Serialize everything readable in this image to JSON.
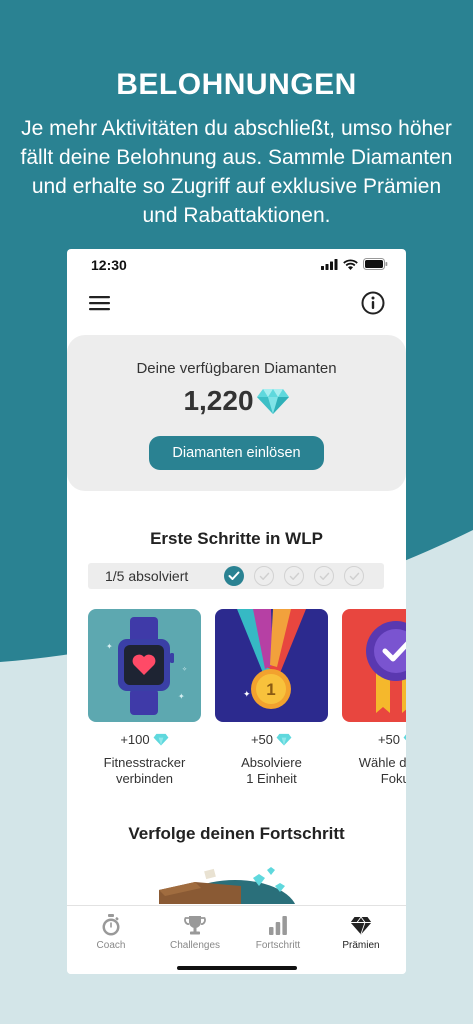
{
  "promo": {
    "title": "BELOHNUNGEN",
    "text": "Je mehr Aktivitäten du abschließt, umso höher fällt deine Belohnung aus. Sammle Diamanten und erhalte so Zugriff auf exklusive Prämien und Rabattaktionen."
  },
  "status_bar": {
    "time": "12:30"
  },
  "diamonds": {
    "label": "Deine verfügbaren Diamanten",
    "amount": "1,220",
    "redeem_label": "Diamanten einlösen"
  },
  "first_steps": {
    "title": "Erste Schritte in WLP",
    "progress_label": "1/5 absolviert",
    "completed": 1,
    "total": 5,
    "tasks": [
      {
        "reward": "+100",
        "name_line1": "Fitnesstracker",
        "name_line2": "verbinden",
        "icon": "smartwatch-heart-icon"
      },
      {
        "reward": "+50",
        "name_line1": "Absolviere",
        "name_line2": "1 Einheit",
        "icon": "medal-icon"
      },
      {
        "reward": "+50",
        "name_line1": "Wähle deinen",
        "name_line2": "Fokus",
        "icon": "badge-check-icon"
      }
    ]
  },
  "progress_section": {
    "title": "Verfolge deinen Fortschritt"
  },
  "tabs": [
    {
      "label": "Coach",
      "icon": "stopwatch-icon",
      "active": false
    },
    {
      "label": "Challenges",
      "icon": "trophy-icon",
      "active": false
    },
    {
      "label": "Fortschritt",
      "icon": "bar-chart-icon",
      "active": false
    },
    {
      "label": "Prämien",
      "icon": "diamond-icon",
      "active": true
    }
  ],
  "colors": {
    "brand_teal": "#2a8292",
    "light_bg": "#d3e5e8",
    "diamond": "#5fd8dd"
  }
}
